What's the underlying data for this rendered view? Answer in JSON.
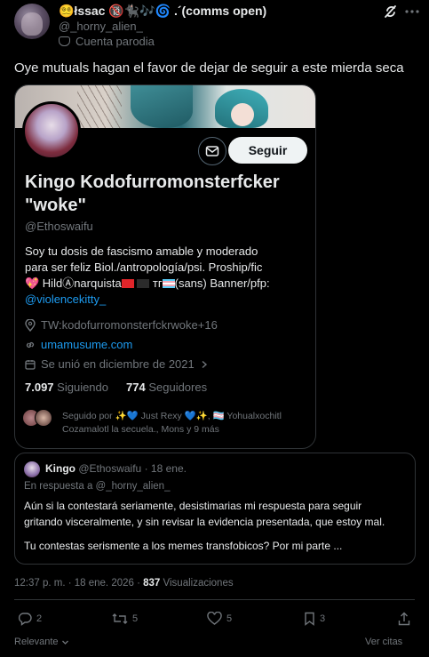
{
  "author": {
    "name": "😵‍💫łssac 🔞🐈‍⬛🎶🌀 .´(comms open)",
    "handle": "@_horny_alien_",
    "parody_label": "Cuenta parodia"
  },
  "tweet_text": "Oye mutuals hagan el favor de dejar de seguir a este mierda seca",
  "card": {
    "follow_label": "Seguir",
    "name": "Kingo Kodofurromonsterfcker \"woke\"",
    "handle": "@Ethoswaifu",
    "bio_line1": "Soy tu dosis de fascismo amable y moderado",
    "bio_line2": "para ser feliz  Biol./antropología/psi. Proship/fic",
    "bio_line3a": "💖 HildⒶnarquista",
    "bio_line3b": " тг",
    "bio_line3c": "(sans) Banner/pfp:",
    "bio_link": "@violencekitty_",
    "location": "TW:kodofurromonsterfckrwoke+16",
    "website": "umamusume.com",
    "joined": "Se unió en diciembre de 2021",
    "following_count": "7.097",
    "following_label": "Siguiendo",
    "followers_count": "774",
    "followers_label": "Seguidores",
    "followed_by_line1": "Seguido por ✨💙 Just Rexy 💙✨, 🏳️‍⚧️ Yohualxochitl",
    "followed_by_line2": "Cozamalotl la secuela., Mons y 9 más"
  },
  "quote": {
    "name": "Kingo",
    "handle": "@Ethoswaifu",
    "time": "· 18 ene.",
    "reply_to": "En respuesta a @_horny_alien_",
    "body_line1": "Aún si la contestará seriamente, desistimarias mi respuesta para seguir",
    "body_line2": "gritando visceralmente, y sin revisar la evidencia presentada, que estoy mal.",
    "body_line3": "Tu contestas serismente a los memes transfobicos? Por mi parte ..."
  },
  "meta": {
    "timestamp": "12:37 p. m. · 18 ene. 2026 ·",
    "views_count": "837",
    "views_label": "Visualizaciones"
  },
  "actions": {
    "replies": "2",
    "reposts": "5",
    "likes": "5",
    "bookmarks": "3"
  },
  "footer": {
    "sort_label": "Relevante",
    "quotes_label": "Ver citas"
  },
  "colors": {
    "background": "#000000",
    "text": "#e7e9ea",
    "muted": "#71767b",
    "link": "#1d9bf0",
    "border": "#2f3336"
  }
}
